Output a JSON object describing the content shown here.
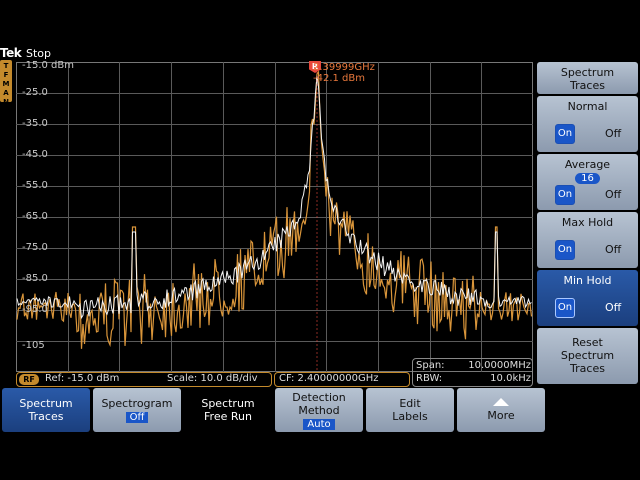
{
  "header": {
    "logo": "Tek",
    "acq_state": "Stop"
  },
  "man_indicator": [
    "T",
    "F",
    "M",
    "A",
    "N"
  ],
  "graticule": {
    "ref_labels": [
      "-15.0 dBm",
      "-25.0",
      "-35.0",
      "-45.0",
      "-55.0",
      "-65.0",
      "-75.0",
      "-85.0",
      "-95.0",
      "-105"
    ]
  },
  "marker": {
    "flag": "R",
    "frequency": "2.39999GHz",
    "level": "-42.1 dBm"
  },
  "readouts": {
    "rf_badge": "RF",
    "ref": "Ref: -15.0 dBm",
    "scale": "Scale: 10.0 dB/div",
    "cf": "CF:  2.40000000GHz",
    "span_label": "Span:",
    "span_value": "10.0000MHz",
    "rbw_label": "RBW:",
    "rbw_value": "10.0kHz"
  },
  "side_menu": {
    "title_line1": "Spectrum",
    "title_line2": "Traces",
    "normal": {
      "label": "Normal",
      "on": "On",
      "off": "Off"
    },
    "average": {
      "label": "Average",
      "count": "16",
      "on": "On",
      "off": "Off"
    },
    "max_hold": {
      "label": "Max Hold",
      "on": "On",
      "off": "Off"
    },
    "min_hold": {
      "label": "Min Hold",
      "on": "On",
      "off": "Off"
    },
    "reset": {
      "line1": "Reset",
      "line2": "Spectrum",
      "line3": "Traces"
    }
  },
  "bottom_menu": {
    "spectrum_traces": {
      "line1": "Spectrum",
      "line2": "Traces"
    },
    "spectrogram": {
      "line1": "Spectrogram",
      "value": "Off"
    },
    "free_run": {
      "line1": "Spectrum",
      "line2": "Free Run"
    },
    "detection": {
      "line1": "Detection",
      "line2": "Method",
      "value": "Auto"
    },
    "edit_labels": {
      "line1": "Edit",
      "line2": "Labels"
    },
    "more": {
      "label": "More"
    }
  },
  "colors": {
    "trace_orange": "#d9953a",
    "trace_white": "#f4f4f4",
    "accent_blue": "#1a56c8",
    "grid": "#5a5a5a"
  }
}
